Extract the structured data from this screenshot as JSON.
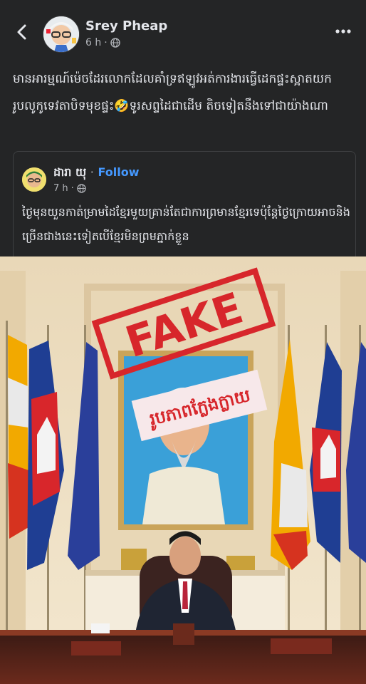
{
  "post": {
    "author": "Srey Pheap",
    "time": "6 h",
    "separator": "·",
    "text": "មានអារម្មណ៍ម៉េចដែរលោកដែលគាំទ្រឥឡូវអត់ការងារធ្វើដេកផ្ទះស្អាតយករូបលូកូទេវតាបិទមុខផ្ទះ🤣ទូរសព្ទដៃជាដើម  តិចទៀតនឹងទៅជាយ៉ាងណា"
  },
  "shared": {
    "author": "ដារា យុ",
    "separator": "·",
    "follow": "Follow",
    "time": "7 h",
    "text": "ថ្ងៃមុនយួនកាត់ម្រាមដៃខ្មែរមួយគ្រាន់តែជាការព្រមានខ្មែរទេប៉ុន្តែថ្ងៃក្រោយអាចនិងច្រើនជាងនេះទៀតបើខ្មែរមិនព្រមភ្នាក់ខ្លួន"
  },
  "photo": {
    "stamp": "FAKE",
    "caption": "រូបភាពក្លែងក្លាយ"
  },
  "icons": {
    "back": "chevron-left-icon",
    "more": "more-dots-icon",
    "privacy": "globe-icon"
  },
  "colors": {
    "background": "#242526",
    "link": "#4599ff",
    "stamp": "#d7262b"
  }
}
